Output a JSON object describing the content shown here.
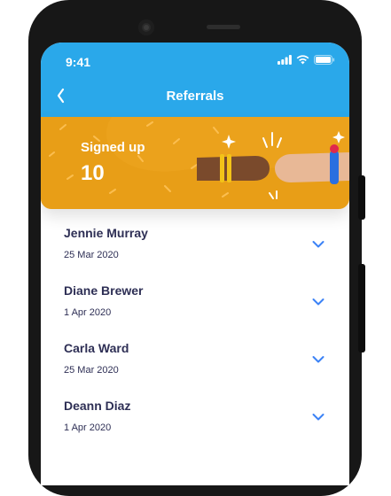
{
  "status_bar": {
    "time": "9:41"
  },
  "header": {
    "title": "Referrals"
  },
  "banner": {
    "label": "Signed up",
    "value": "10"
  },
  "referrals": [
    {
      "name": "Jennie Murray",
      "date": "25 Mar 2020"
    },
    {
      "name": "Diane Brewer",
      "date": "1 Apr 2020"
    },
    {
      "name": "Carla Ward",
      "date": "25 Mar 2020"
    },
    {
      "name": "Deann Diaz",
      "date": "1 Apr 2020"
    }
  ],
  "colors": {
    "accent": "#2aa8ea",
    "banner": "#eba21c",
    "text": "#2e2f55",
    "chevron": "#3b82f6"
  }
}
